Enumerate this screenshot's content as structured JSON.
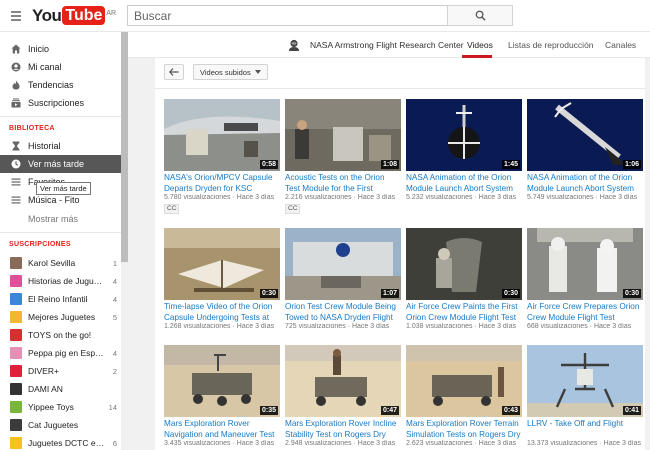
{
  "header": {
    "logo_you": "You",
    "logo_tube": "Tube",
    "logo_region": "AR",
    "search_placeholder": "Buscar"
  },
  "sidebar": {
    "nav": [
      {
        "label": "Inicio",
        "icon": "home-icon"
      },
      {
        "label": "Mi canal",
        "icon": "person-icon"
      },
      {
        "label": "Tendencias",
        "icon": "flame-icon"
      },
      {
        "label": "Suscripciones",
        "icon": "subscriptions-icon"
      }
    ],
    "library_title": "BIBLIOTECA",
    "library": [
      {
        "label": "Historial",
        "icon": "hourglass-icon"
      },
      {
        "label": "Ver más tarde",
        "icon": "clock-icon",
        "active": true
      },
      {
        "label": "Favoritos",
        "icon": "list-icon"
      },
      {
        "label": "Música - Fito",
        "icon": "list-icon"
      }
    ],
    "show_more": "Mostrar más",
    "tooltip": "Ver más tarde",
    "subs_title": "SUSCRIPCIONES",
    "subscriptions": [
      {
        "name": "Karol Sevilla",
        "count": "1",
        "color": "#8a6a58"
      },
      {
        "name": "Historias de Juguetes",
        "count": "4",
        "color": "#e04f9a"
      },
      {
        "name": "El Reino Infantil",
        "count": "4",
        "color": "#3a86d8"
      },
      {
        "name": "Mejores Juguetes",
        "count": "5",
        "color": "#f2b632"
      },
      {
        "name": "TOYS on the go!",
        "count": "",
        "color": "#d3302f"
      },
      {
        "name": "Peppa pig en Español",
        "count": "4",
        "color": "#e58fb5"
      },
      {
        "name": "DIVER+",
        "count": "2",
        "color": "#e0203a"
      },
      {
        "name": "DAMI AN",
        "count": "",
        "color": "#333333"
      },
      {
        "name": "Yippee Toys",
        "count": "14",
        "color": "#79b43b"
      },
      {
        "name": "Cat Juguetes",
        "count": "",
        "color": "#3b3b3b"
      },
      {
        "name": "Juguetes DCTC en Español",
        "count": "6",
        "color": "#f6c21b"
      }
    ]
  },
  "channel": {
    "name": "NASA Armstrong Flight Research Center",
    "tabs": [
      "Videos",
      "Listas de reproducción",
      "Canales"
    ],
    "active_tab": "Videos"
  },
  "toolbar": {
    "dropdown_label": "Videos subidos"
  },
  "videos": [
    {
      "title": "NASA's Orion/MPCV Capsule Departs Dryden for KSC",
      "views": "5.780 visualizaciones",
      "age": "Hace 3 días",
      "duration": "0:58",
      "cc": "CC"
    },
    {
      "title": "Acoustic Tests on the Orion Test Module for the First Launch",
      "views": "2.216 visualizaciones",
      "age": "Hace 3 días",
      "duration": "1:08",
      "cc": "CC"
    },
    {
      "title": "NASA Animation of the Orion Module Launch Abort System",
      "views": "5.232 visualizaciones",
      "age": "Hace 3 días",
      "duration": "1:45",
      "cc": ""
    },
    {
      "title": "NASA Animation of the Orion Module Launch Abort System",
      "views": "5.749 visualizaciones",
      "age": "Hace 3 días",
      "duration": "1:06",
      "cc": ""
    },
    {
      "title": "Time-lapse Video of the Orion Capsule Undergoing Tests at",
      "views": "1.268 visualizaciones",
      "age": "Hace 3 días",
      "duration": "0:30",
      "cc": ""
    },
    {
      "title": "Orion Test Crew Module Being Towed to NASA Dryden Flight",
      "views": "725 visualizaciones",
      "age": "Hace 3 días",
      "duration": "1:07",
      "cc": ""
    },
    {
      "title": "Air Force Crew Paints the First Orion Crew Module Flight Test",
      "views": "1.038 visualizaciones",
      "age": "Hace 3 días",
      "duration": "0:30",
      "cc": ""
    },
    {
      "title": "Air Force Crew Prepares Orion Crew Module Flight Test Vehicl...",
      "views": "668 visualizaciones",
      "age": "Hace 3 días",
      "duration": "0:30",
      "cc": ""
    },
    {
      "title": "Mars Exploration Rover Navigation and Maneuver Test ...",
      "views": "3.435 visualizaciones",
      "age": "Hace 3 días",
      "duration": "0:35",
      "cc": ""
    },
    {
      "title": "Mars Exploration Rover Incline Stability Test on Rogers Dry Lake",
      "views": "2.948 visualizaciones",
      "age": "Hace 3 días",
      "duration": "0:47",
      "cc": ""
    },
    {
      "title": "Mars Exploration Rover Terrain Simulation Tests on Rogers Dry",
      "views": "2.623 visualizaciones",
      "age": "Hace 3 días",
      "duration": "0:43",
      "cc": ""
    },
    {
      "title": "LLRV - Take Off and Flight",
      "views": "13.373 visualizaciones",
      "age": "Hace 3 días",
      "duration": "0:41",
      "cc": ""
    }
  ]
}
